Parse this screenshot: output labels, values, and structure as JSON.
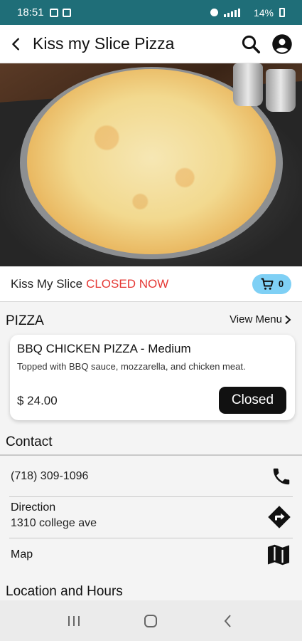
{
  "status_bar": {
    "time": "18:51",
    "battery": "14%"
  },
  "header": {
    "title": "Kiss my Slice Pizza"
  },
  "store": {
    "name": "Kiss My Slice",
    "status": "CLOSED NOW",
    "cart_count": "0"
  },
  "menu_section": {
    "title": "PIZZA",
    "view_menu": "View Menu",
    "item": {
      "name": "BBQ CHICKEN PIZZA - Medium",
      "description": "Topped with BBQ sauce, mozzarella, and chicken meat.",
      "price": "$ 24.00",
      "button": "Closed"
    }
  },
  "contact": {
    "title": "Contact",
    "phone": "(718) 309-1096",
    "direction_label": "Direction",
    "address": "1310 college ave",
    "map_label": "Map"
  },
  "location_title": "Location and Hours",
  "colors": {
    "status_bar": "#1f6e78",
    "closed_red": "#e53935",
    "cart_pill": "#7fd0f5"
  },
  "icons": [
    "back-arrow-icon",
    "search-icon",
    "account-icon",
    "cart-icon",
    "chevron-right-icon",
    "phone-icon",
    "directions-icon",
    "map-icon"
  ]
}
